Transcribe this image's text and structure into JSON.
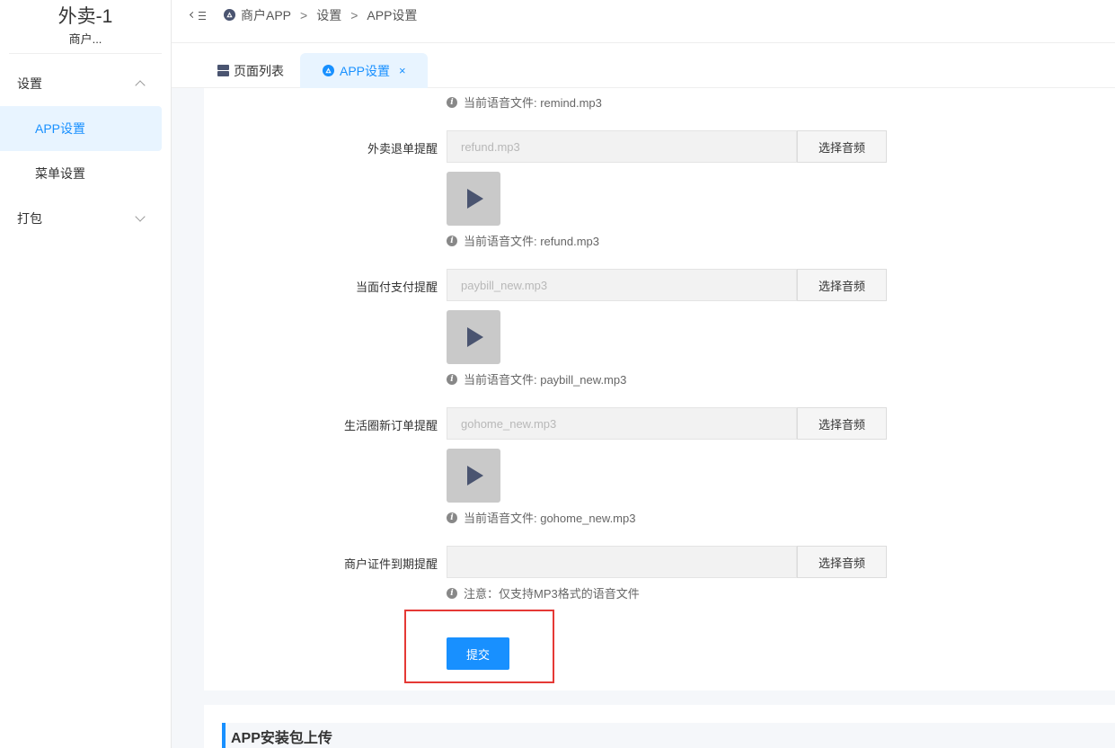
{
  "brand": {
    "title": "外卖-1",
    "subtitle": "商户..."
  },
  "sidebar": {
    "groups": [
      {
        "label": "设置",
        "items": [
          "APP设置",
          "菜单设置"
        ]
      },
      {
        "label": "打包"
      }
    ]
  },
  "breadcrumb": {
    "items": [
      "商户APP",
      "设置",
      "APP设置"
    ],
    "separator": ">"
  },
  "tabs": [
    {
      "label": "页面列表"
    },
    {
      "label": "APP设置",
      "close": "×"
    }
  ],
  "form": {
    "top_hint": "当前语音文件: remind.mp3",
    "rows": [
      {
        "label": "外卖退单提醒",
        "value": "refund.mp3",
        "button": "选择音频",
        "hint": "当前语音文件: refund.mp3"
      },
      {
        "label": "当面付支付提醒",
        "value": "paybill_new.mp3",
        "button": "选择音频",
        "hint": "当前语音文件: paybill_new.mp3"
      },
      {
        "label": "生活圈新订单提醒",
        "value": "gohome_new.mp3",
        "button": "选择音频",
        "hint": "当前语音文件: gohome_new.mp3"
      },
      {
        "label": "商户证件到期提醒",
        "value": "",
        "button": "选择音频",
        "hint": "注意：仅支持MP3格式的语音文件"
      }
    ],
    "info_glyph": "i",
    "submit": "提交"
  },
  "section2": {
    "title": "APP安装包上传"
  },
  "colors": {
    "accent": "#1890ff",
    "highlight": "#e53935",
    "play_bg": "#c9c9c9"
  },
  "icons": {
    "fold": "menu-fold-icon",
    "app": "android-app-icon",
    "page": "page-list-icon",
    "play": "play-icon",
    "info": "info-icon"
  }
}
